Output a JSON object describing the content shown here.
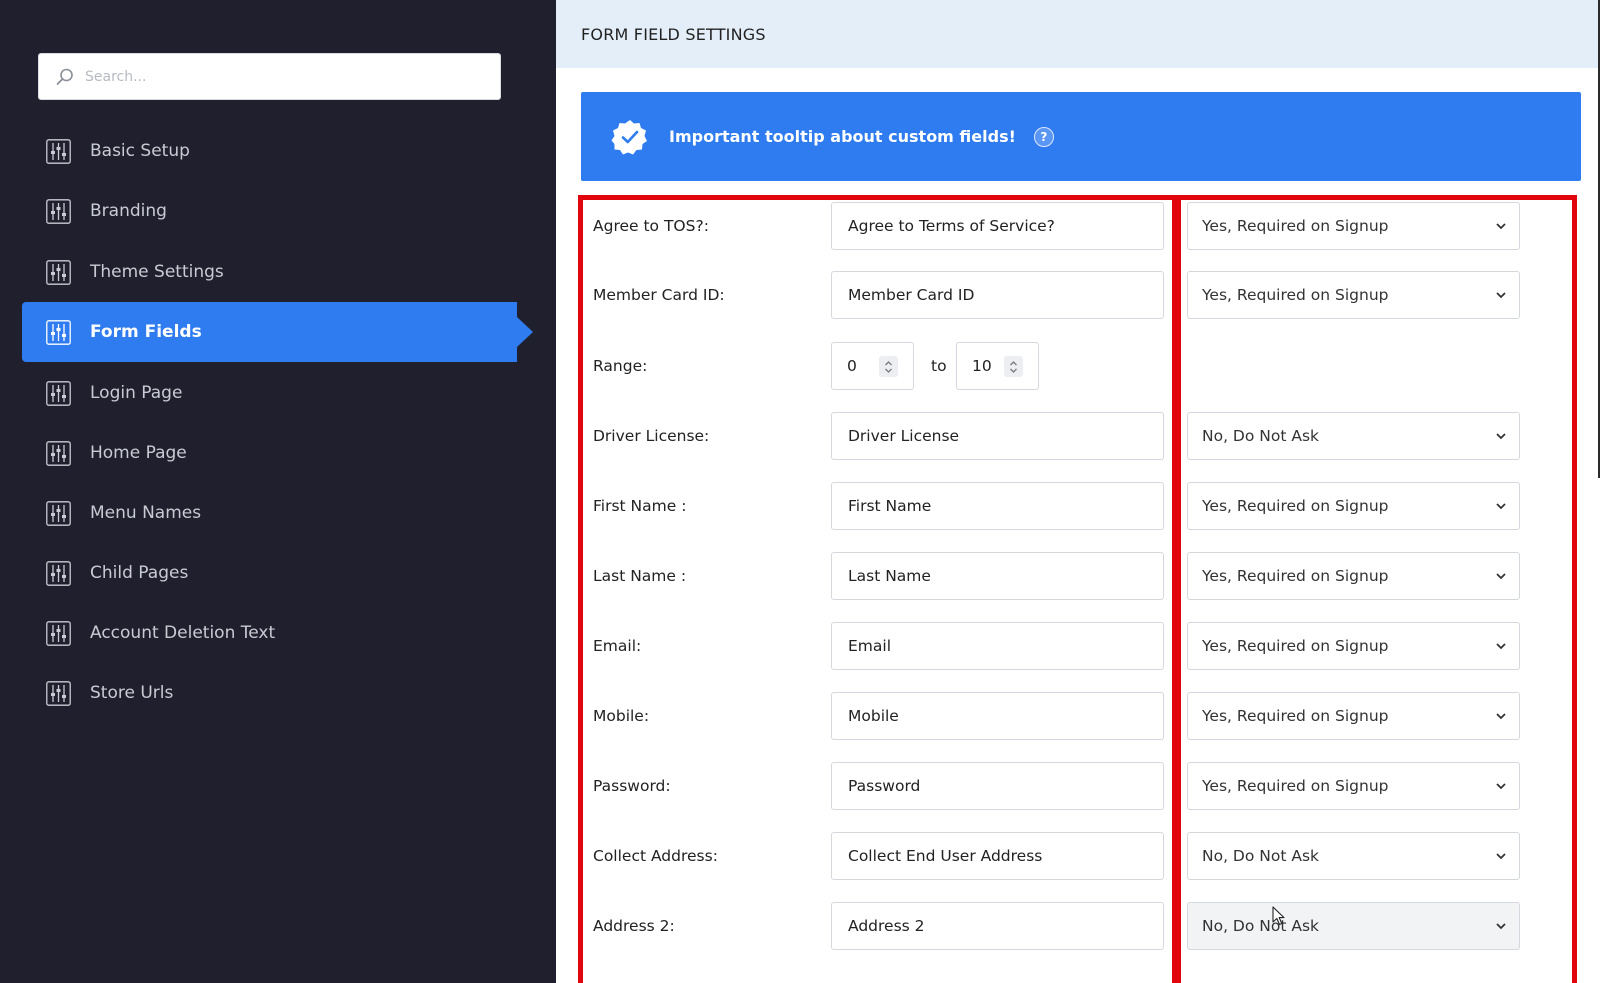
{
  "sidebar": {
    "search": {
      "placeholder": "Search..."
    },
    "items": [
      {
        "label": "Basic Setup",
        "active": false
      },
      {
        "label": "Branding",
        "active": false
      },
      {
        "label": "Theme Settings",
        "active": false
      },
      {
        "label": "Form Fields",
        "active": true
      },
      {
        "label": "Login Page",
        "active": false
      },
      {
        "label": "Home Page",
        "active": false
      },
      {
        "label": "Menu Names",
        "active": false
      },
      {
        "label": "Child Pages",
        "active": false
      },
      {
        "label": "Account Deletion Text",
        "active": false
      },
      {
        "label": "Store Urls",
        "active": false
      }
    ]
  },
  "main": {
    "title": "FORM FIELD SETTINGS",
    "banner": {
      "text": "Important tooltip about custom fields!",
      "help_icon": "?"
    },
    "fields": [
      {
        "label": "Agree to TOS?:",
        "value": "Agree to Terms of Service?",
        "option": "Yes, Required on Signup"
      },
      {
        "label": "Member Card ID:",
        "value": "Member Card ID",
        "option": "Yes, Required on Signup"
      },
      {
        "label": "Driver License:",
        "value": "Driver License",
        "option": "No, Do Not Ask"
      },
      {
        "label": "First Name :",
        "value": "First Name",
        "option": "Yes, Required on Signup"
      },
      {
        "label": "Last Name :",
        "value": "Last Name",
        "option": "Yes, Required on Signup"
      },
      {
        "label": "Email:",
        "value": "Email",
        "option": "Yes, Required on Signup"
      },
      {
        "label": "Mobile:",
        "value": "Mobile",
        "option": "Yes, Required on Signup"
      },
      {
        "label": "Password:",
        "value": "Password",
        "option": "Yes, Required on Signup"
      },
      {
        "label": "Collect Address:",
        "value": "Collect End User Address",
        "option": "No, Do Not Ask"
      },
      {
        "label": "Address 2:",
        "value": "Address 2",
        "option": "No, Do Not Ask"
      }
    ],
    "range": {
      "label": "Range:",
      "min": "0",
      "separator": "to",
      "max": "10"
    }
  },
  "colors": {
    "sidebar_bg": "#1f1f2d",
    "accent": "#2e7cf0",
    "highlight_border": "#e1060e",
    "header_bg": "#e4eef8"
  }
}
